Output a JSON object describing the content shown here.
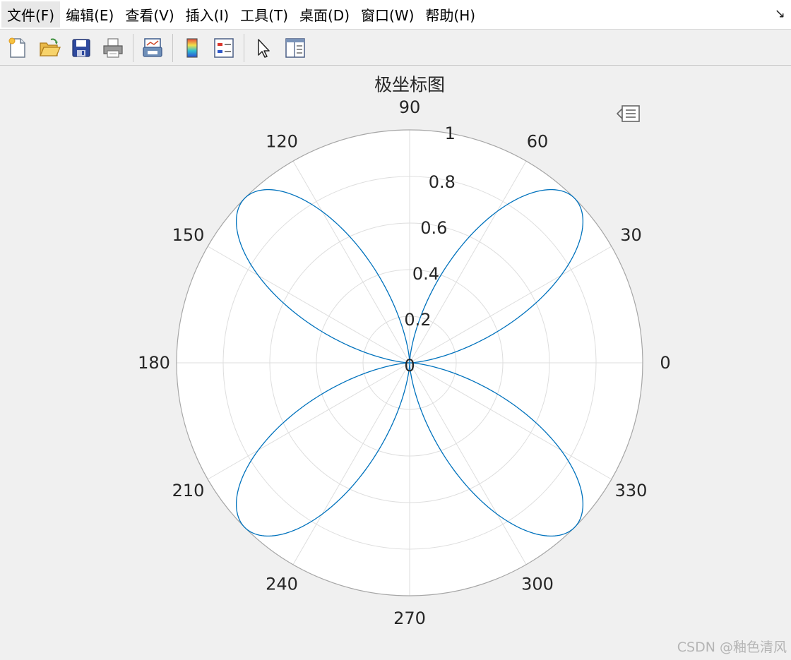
{
  "menu": {
    "items": [
      "文件(F)",
      "编辑(E)",
      "查看(V)",
      "插入(I)",
      "工具(T)",
      "桌面(D)",
      "窗口(W)",
      "帮助(H)"
    ],
    "corner_glyph": "↘"
  },
  "toolbar": {
    "icons": [
      "new-figure-icon",
      "open-file-icon",
      "save-icon",
      "print-icon",
      "link-plot-icon",
      "colorbar-icon",
      "legend-icon",
      "pointer-icon",
      "property-inspector-icon"
    ]
  },
  "watermark": "CSDN @釉色清风",
  "colors": {
    "series": "#0072bd",
    "grid": "#dedede",
    "axis_circle": "#a6a6a6",
    "text": "#262626"
  },
  "chart_data": {
    "type": "polar-line",
    "title": "极坐标图",
    "series": [
      {
        "function": "rho = sin(2*theta)^2",
        "theta_range_deg": [
          0,
          360
        ]
      }
    ],
    "r_ticks": [
      0,
      0.2,
      0.4,
      0.6,
      0.8,
      1
    ],
    "r_tick_labels": [
      "0",
      "0.2",
      "0.4",
      "0.6",
      "0.8",
      "1"
    ],
    "rlim": [
      0,
      1
    ],
    "theta_ticks": [
      0,
      30,
      60,
      90,
      120,
      150,
      180,
      210,
      240,
      270,
      300,
      330
    ],
    "theta_tick_labels": [
      "0",
      "30",
      "60",
      "90",
      "120",
      "150",
      "180",
      "210",
      "240",
      "270",
      "300",
      "330"
    ],
    "grid": true
  }
}
